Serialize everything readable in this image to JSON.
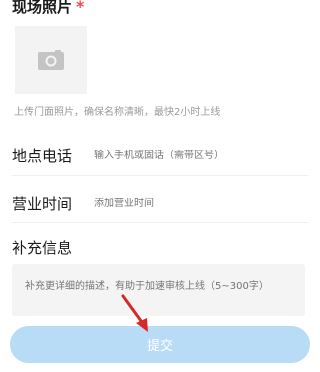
{
  "photo": {
    "title": "现场照片",
    "required_mark": "*",
    "upload_hint": "上传门面照片，确保名称清晰，最快2小时上线"
  },
  "phone": {
    "label": "地点电话",
    "placeholder": "输入手机或固话（需带区号）"
  },
  "hours": {
    "label": "营业时间",
    "placeholder": "添加营业时间"
  },
  "extra": {
    "label": "补充信息",
    "placeholder": "补充更详细的描述，有助于加速审核上线（5~300字）"
  },
  "submit": {
    "label": "提交"
  },
  "colors": {
    "required": "#e84a4a",
    "submit_bg": "#b9dcf6",
    "annotation_arrow": "#d62a2a"
  },
  "icons": {
    "upload": "camera-icon",
    "annotation": "red-arrow-annotation"
  }
}
